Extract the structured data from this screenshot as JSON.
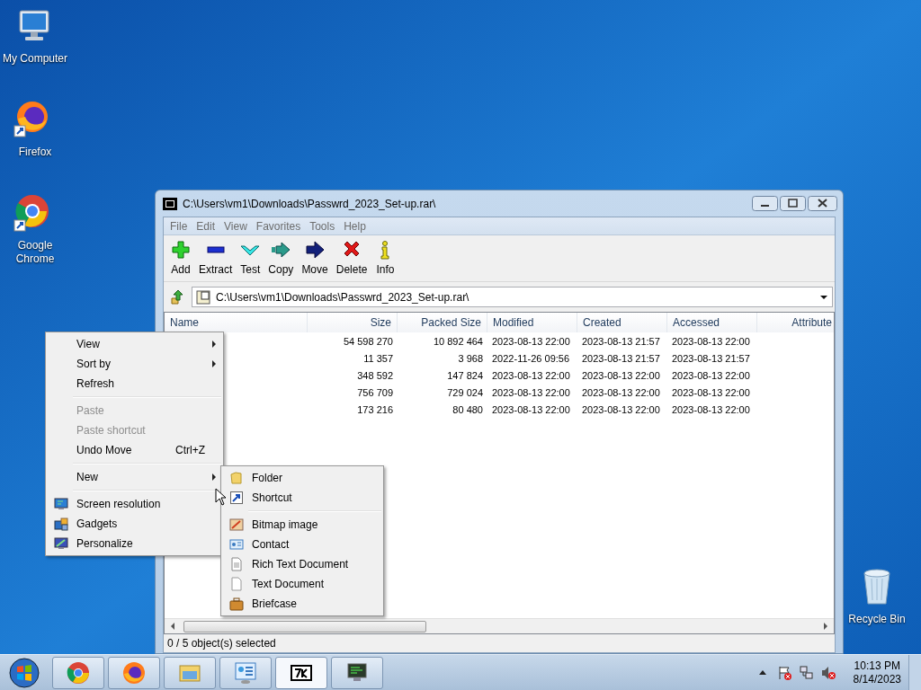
{
  "desktop_icons": [
    {
      "label": "My Computer"
    },
    {
      "label": "Firefox"
    },
    {
      "label": "Google Chrome"
    },
    {
      "label": "Recycle Bin"
    }
  ],
  "window": {
    "title": "C:\\Users\\vm1\\Downloads\\Passwrd_2023_Set-up.rar\\",
    "menu": [
      "File",
      "Edit",
      "View",
      "Favorites",
      "Tools",
      "Help"
    ],
    "toolbar": [
      {
        "label": "Add"
      },
      {
        "label": "Extract"
      },
      {
        "label": "Test"
      },
      {
        "label": "Copy"
      },
      {
        "label": "Move"
      },
      {
        "label": "Delete"
      },
      {
        "label": "Info"
      }
    ],
    "address": "C:\\Users\\vm1\\Downloads\\Passwrd_2023_Set-up.rar\\",
    "columns": [
      "Name",
      "Size",
      "Packed Size",
      "Modified",
      "Created",
      "Accessed",
      "Attribute"
    ],
    "rows": [
      {
        "size": "54 598 270",
        "packed_size": "10 892 464",
        "modified": "2023-08-13 22:00",
        "created": "2023-08-13 21:57",
        "accessed": "2023-08-13 22:00"
      },
      {
        "size": "11 357",
        "packed_size": "3 968",
        "modified": "2022-11-26 09:56",
        "created": "2023-08-13 21:57",
        "accessed": "2023-08-13 21:57"
      },
      {
        "size": "348 592",
        "packed_size": "147 824",
        "modified": "2023-08-13 22:00",
        "created": "2023-08-13 22:00",
        "accessed": "2023-08-13 22:00"
      },
      {
        "size": "756 709",
        "packed_size": "729 024",
        "modified": "2023-08-13 22:00",
        "created": "2023-08-13 22:00",
        "accessed": "2023-08-13 22:00"
      },
      {
        "size": "173 216",
        "packed_size": "80 480",
        "modified": "2023-08-13 22:00",
        "created": "2023-08-13 22:00",
        "accessed": "2023-08-13 22:00"
      }
    ],
    "status": "0 / 5 object(s) selected"
  },
  "context_menu": {
    "items": [
      {
        "kind": "item",
        "label": "View",
        "submenu": true,
        "disabled": false
      },
      {
        "kind": "item",
        "label": "Sort by",
        "submenu": true,
        "disabled": false
      },
      {
        "kind": "item",
        "label": "Refresh",
        "submenu": false,
        "disabled": false
      },
      {
        "kind": "separator"
      },
      {
        "kind": "item",
        "label": "Paste",
        "submenu": false,
        "disabled": true
      },
      {
        "kind": "item",
        "label": "Paste shortcut",
        "submenu": false,
        "disabled": true
      },
      {
        "kind": "item",
        "label": "Undo Move",
        "shortcut": "Ctrl+Z",
        "submenu": false,
        "disabled": false
      },
      {
        "kind": "separator"
      },
      {
        "kind": "item",
        "label": "New",
        "submenu": true,
        "disabled": false
      },
      {
        "kind": "separator"
      },
      {
        "kind": "item",
        "label": "Screen resolution",
        "submenu": false,
        "disabled": false
      },
      {
        "kind": "item",
        "label": "Gadgets",
        "submenu": false,
        "disabled": false
      },
      {
        "kind": "item",
        "label": "Personalize",
        "submenu": false,
        "disabled": false
      }
    ]
  },
  "new_submenu": {
    "items": [
      {
        "kind": "item",
        "label": "Folder"
      },
      {
        "kind": "item",
        "label": "Shortcut"
      },
      {
        "kind": "separator"
      },
      {
        "kind": "item",
        "label": "Bitmap image"
      },
      {
        "kind": "item",
        "label": "Contact"
      },
      {
        "kind": "item",
        "label": "Rich Text Document"
      },
      {
        "kind": "item",
        "label": "Text Document"
      },
      {
        "kind": "item",
        "label": "Briefcase"
      }
    ]
  },
  "taskbar": {
    "time": "10:13 PM",
    "date": "8/14/2023"
  }
}
